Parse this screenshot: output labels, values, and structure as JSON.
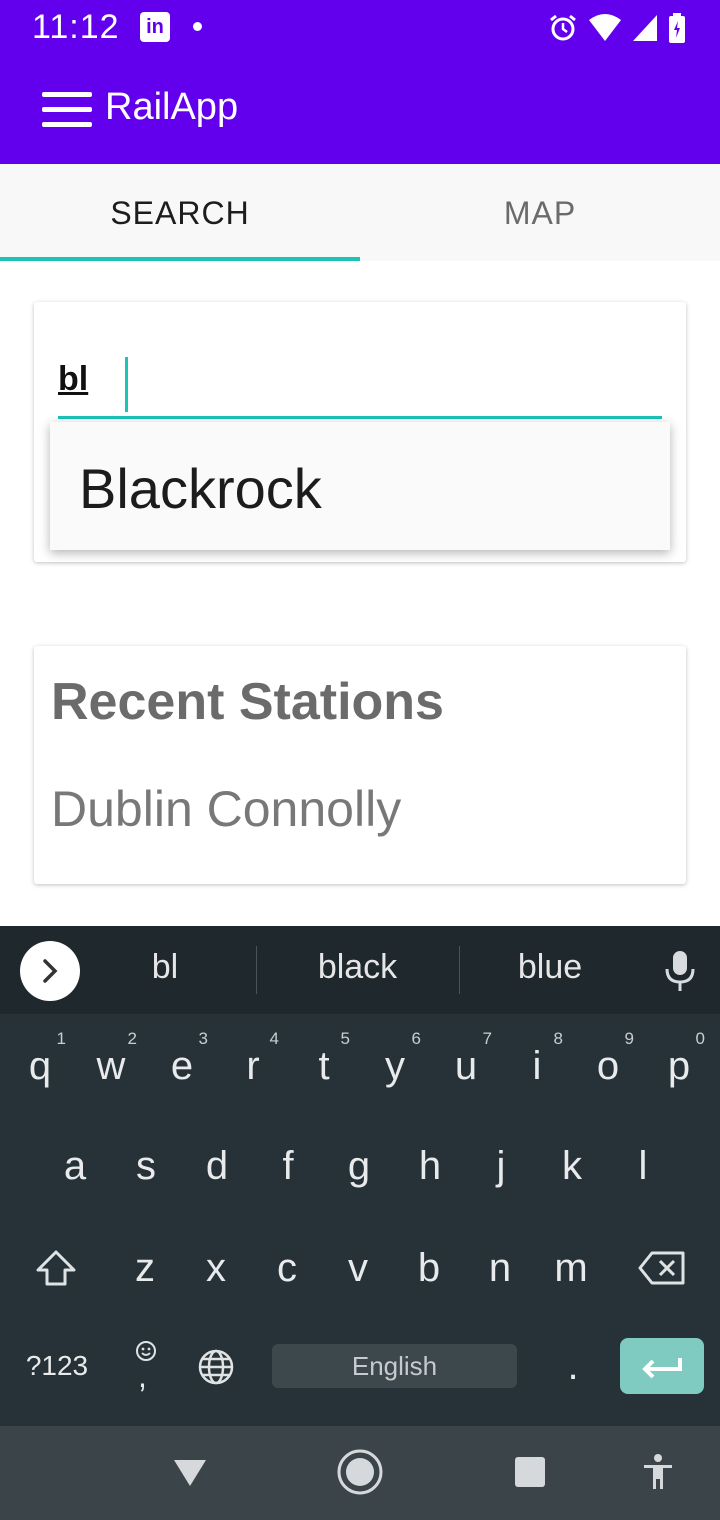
{
  "status_bar": {
    "time": "11:12",
    "linkedin_icon": "linkedin-icon"
  },
  "app_bar": {
    "title": "RailApp",
    "menu_icon": "hamburger-menu-icon"
  },
  "tabs": [
    {
      "label": "SEARCH",
      "active": true
    },
    {
      "label": "MAP",
      "active": false
    }
  ],
  "search": {
    "value": "bl"
  },
  "suggestions": [
    "Blackrock"
  ],
  "recent": {
    "title": "Recent Stations",
    "items": [
      "Dublin Connolly"
    ]
  },
  "keyboard": {
    "suggestions": [
      "bl",
      "black",
      "blue"
    ],
    "row1": [
      {
        "k": "q",
        "h": "1"
      },
      {
        "k": "w",
        "h": "2"
      },
      {
        "k": "e",
        "h": "3"
      },
      {
        "k": "r",
        "h": "4"
      },
      {
        "k": "t",
        "h": "5"
      },
      {
        "k": "y",
        "h": "6"
      },
      {
        "k": "u",
        "h": "7"
      },
      {
        "k": "i",
        "h": "8"
      },
      {
        "k": "o",
        "h": "9"
      },
      {
        "k": "p",
        "h": "0"
      }
    ],
    "row2": [
      "a",
      "s",
      "d",
      "f",
      "g",
      "h",
      "j",
      "k",
      "l"
    ],
    "row3": [
      "z",
      "x",
      "c",
      "v",
      "b",
      "n",
      "m"
    ],
    "symbols_label": "?123",
    "emoji_comma": ",",
    "space_label": "English",
    "period": "."
  },
  "colors": {
    "primary": "#6200ee",
    "accent": "#1bc4b7",
    "keyboard_bg": "#263238",
    "enter_key": "#7fcbc2"
  }
}
